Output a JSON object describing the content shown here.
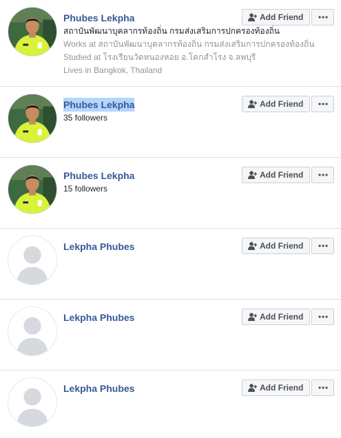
{
  "results": [
    {
      "name": "Phubes Lekpha",
      "avatar": "referee-photo",
      "lines": [
        {
          "text": "สถาบันพัฒนาบุคลากรท้องถิ่น กรมส่งเสริมการปกครองท้องถิ่น",
          "style": "dark"
        },
        {
          "text": "Works at สถาบันพัฒนาบุคลากรท้องถิ่น กรมส่งเสริมการปกครองท้องถิ่น",
          "style": "grey"
        },
        {
          "text": "Studied at โรงเรียนวัดหนองหอย อ.โคกสำโรง จ.ลพบุรี",
          "style": "grey"
        },
        {
          "text": "Lives in Bangkok, Thailand",
          "style": "grey"
        }
      ],
      "add_friend_label": "Add Friend",
      "more_icon": "more-dots-icon"
    },
    {
      "name": "Phubes Lekpha",
      "selected": true,
      "avatar": "referee-photo",
      "lines": [
        {
          "text": "35 followers",
          "style": "dark"
        }
      ],
      "add_friend_label": "Add Friend",
      "more_icon": "more-dots-icon"
    },
    {
      "name": "Phubes Lekpha",
      "avatar": "referee-photo",
      "lines": [
        {
          "text": "15 followers",
          "style": "dark"
        }
      ],
      "add_friend_label": "Add Friend",
      "more_icon": "more-dots-icon"
    },
    {
      "name": "Lekpha Phubes",
      "avatar": "default-avatar",
      "lines": [],
      "add_friend_label": "Add Friend",
      "more_icon": "more-dots-icon"
    },
    {
      "name": "Lekpha Phubes",
      "avatar": "default-avatar",
      "lines": [],
      "add_friend_label": "Add Friend",
      "more_icon": "more-dots-icon"
    },
    {
      "name": "Lekpha Phubes",
      "avatar": "default-avatar",
      "lines": [],
      "add_friend_label": "Add Friend",
      "more_icon": "more-dots-icon"
    }
  ],
  "colors": {
    "name_link": "#385898",
    "selection": "#b4d5fe",
    "divider": "#dddfe2",
    "button_bg": "#f5f6f7",
    "jersey": "#d9f23a"
  }
}
